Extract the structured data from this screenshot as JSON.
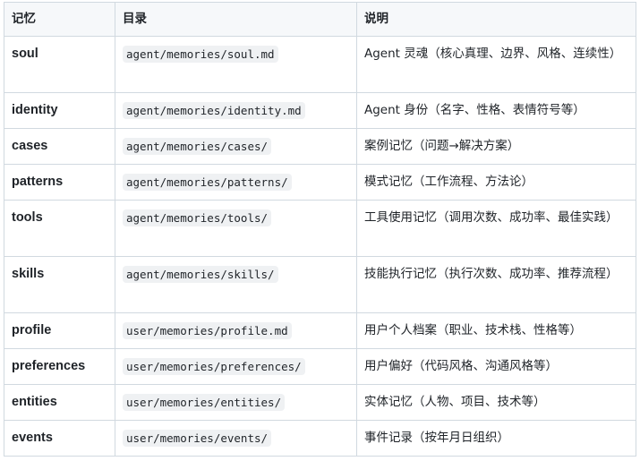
{
  "table": {
    "headers": [
      "记忆",
      "目录",
      "说明"
    ],
    "rows": [
      {
        "key": "soul",
        "path": "agent/memories/soul.md",
        "desc": "Agent 灵魂（核心真理、边界、风格、连续性）"
      },
      {
        "key": "identity",
        "path": "agent/memories/identity.md",
        "desc": "Agent 身份（名字、性格、表情符号等）"
      },
      {
        "key": "cases",
        "path": "agent/memories/cases/",
        "desc": "案例记忆（问题→解决方案）"
      },
      {
        "key": "patterns",
        "path": "agent/memories/patterns/",
        "desc": "模式记忆（工作流程、方法论）"
      },
      {
        "key": "tools",
        "path": "agent/memories/tools/",
        "desc": "工具使用记忆（调用次数、成功率、最佳实践）"
      },
      {
        "key": "skills",
        "path": "agent/memories/skills/",
        "desc": "技能执行记忆（执行次数、成功率、推荐流程）"
      },
      {
        "key": "profile",
        "path": "user/memories/profile.md",
        "desc": "用户个人档案（职业、技术栈、性格等）"
      },
      {
        "key": "preferences",
        "path": "user/memories/preferences/",
        "desc": "用户偏好（代码风格、沟通风格等）"
      },
      {
        "key": "entities",
        "path": "user/memories/entities/",
        "desc": "实体记忆（人物、项目、技术等）"
      },
      {
        "key": "events",
        "path": "user/memories/events/",
        "desc": "事件记录（按年月日组织）"
      }
    ]
  }
}
